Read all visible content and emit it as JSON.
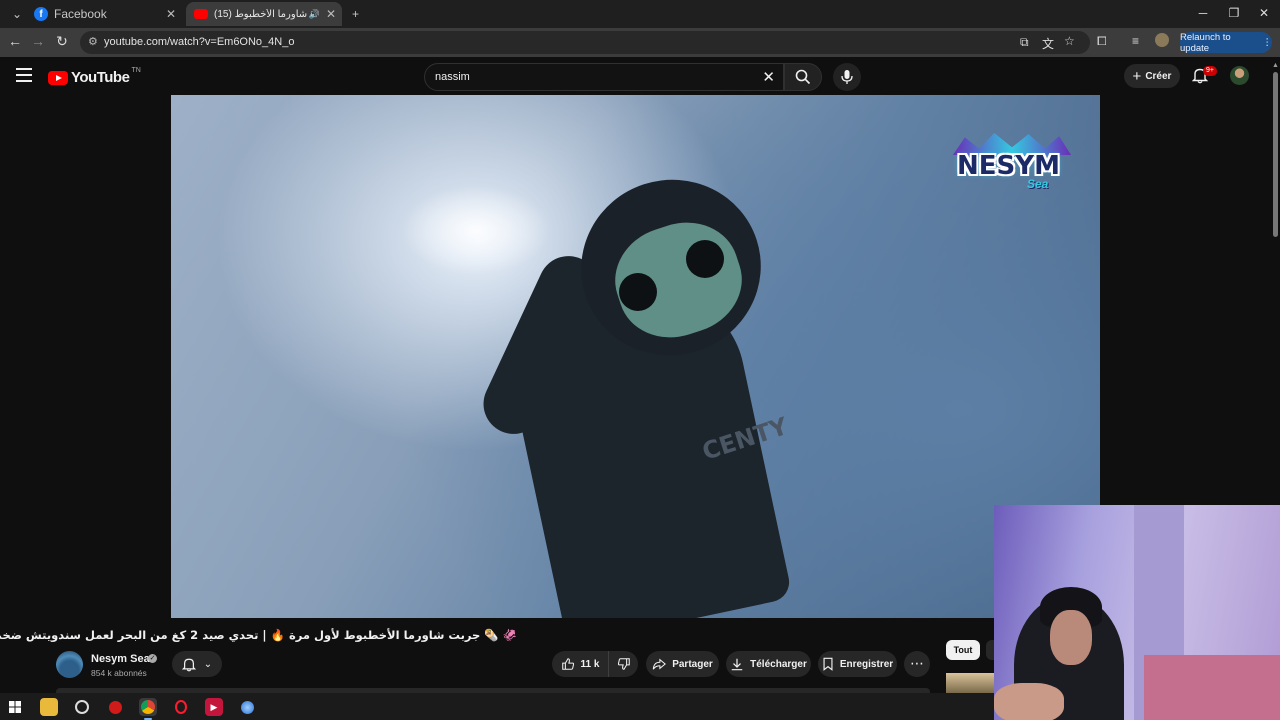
{
  "browser": {
    "tabs": [
      {
        "title": "Facebook",
        "active": false,
        "favicon": "facebook-icon"
      },
      {
        "title": "(15) جربت شاورما الأخطبوط",
        "active": true,
        "favicon": "youtube-icon",
        "audio": true
      }
    ],
    "new_tab": "+",
    "url": "youtube.com/watch?v=Em6ONo_4N_o",
    "relaunch_label": "Relaunch to update"
  },
  "youtube": {
    "logo_text": "YouTube",
    "logo_country": "TN",
    "search_value": "nassim",
    "create_label": "Créer",
    "notification_badge": "9+"
  },
  "video": {
    "overlay_logo": "NESYM",
    "overlay_logo_sub": "Sea",
    "suit_text": "CENTY",
    "title": "🦑 🌯 جربت شاورما الأخطبوط لأول مرة 🔥 | تحدي صيد 2 كغ من البحر لعمل سندويتش ضخم جدًا.."
  },
  "channel": {
    "name": "Nesym Sea",
    "subscribers": "854 k abonnés"
  },
  "actions": {
    "likes": "11 k",
    "share": "Partager",
    "download": "Télécharger",
    "save": "Enregistrer"
  },
  "sidebar": {
    "chip_all": "Tout"
  },
  "colors": {
    "accent": "#ff0000",
    "background": "#0f0f0f",
    "pill": "#272727",
    "relaunch": "#1b4f8c"
  }
}
